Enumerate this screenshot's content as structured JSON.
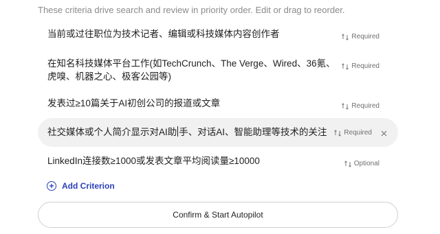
{
  "hint": "These criteria drive search and review in priority order. Edit or drag to reorder.",
  "criteria": [
    {
      "text": "当前或过往职位为技术记者、编辑或科技媒体内容创作者",
      "tag": "Required"
    },
    {
      "text": "在知名科技媒体平台工作(如TechCrunch、The Verge、Wired、36氪、虎嗅、机器之心、极客公园等)",
      "tag": "Required"
    },
    {
      "text": "发表过≥10篇关于AI初创公司的报道或文章",
      "tag": "Required"
    },
    {
      "text_before_caret": "社交媒体或个人简介显示对AI助",
      "text_after_caret": "手、对话AI、智能助理等技术的关注",
      "tag": "Required"
    },
    {
      "text": "LinkedIn连接数≥1000或发表文章平均阅读量≥10000",
      "tag": "Optional"
    }
  ],
  "add_criterion_label": "Add Criterion",
  "confirm_label": "Confirm & Start Autopilot",
  "icons": {
    "tag_icon": "swap-arrows-icon",
    "remove_icon": "close-icon",
    "add_icon": "plus-circle-icon"
  },
  "colors": {
    "accent": "#2a3fb5",
    "active_row_bg": "#f1f1f1"
  }
}
